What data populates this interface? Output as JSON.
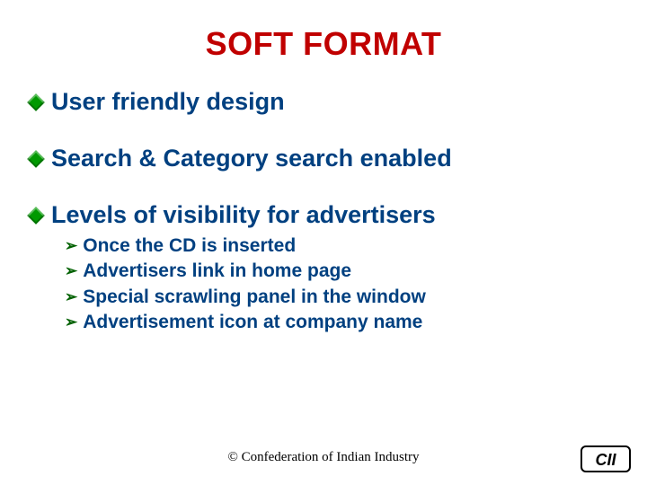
{
  "title": "SOFT FORMAT",
  "bullets": [
    {
      "text": "User friendly design"
    },
    {
      "text": "Search & Category search enabled"
    },
    {
      "text": "Levels of visibility for advertisers"
    }
  ],
  "sub_bullets": [
    {
      "text": "Once the CD is inserted"
    },
    {
      "text": "Advertisers link in home page"
    },
    {
      "text": "Special scrawling panel in the window"
    },
    {
      "text": "Advertisement icon at company name"
    }
  ],
  "footer": "© Confederation of Indian Industry",
  "logo_text": "CII"
}
